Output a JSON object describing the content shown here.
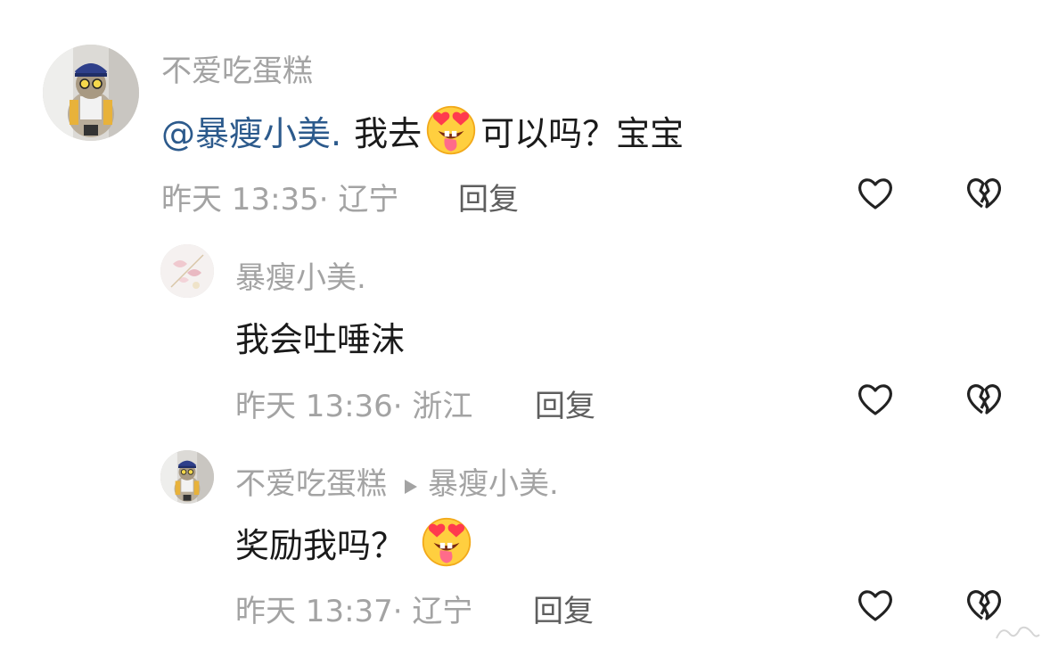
{
  "comments": [
    {
      "author": "不爱吃蛋糕",
      "mention": "@暴瘦小美.",
      "text_before_emoji": "我去",
      "text_after_emoji": "可以吗？宝宝",
      "emoji": "heart-eyes-tongue-emoji",
      "time": "昨天 13:35",
      "location": "· 辽宁",
      "reply_label": "回复",
      "like_icon": "heart-outline-icon",
      "dislike_icon": "broken-heart-icon"
    },
    {
      "author": "暴瘦小美.",
      "text": "我会吐唾沫",
      "time": "昨天 13:36",
      "location": "· 浙江",
      "reply_label": "回复",
      "like_icon": "heart-outline-icon",
      "dislike_icon": "broken-heart-icon"
    },
    {
      "author": "不爱吃蛋糕",
      "reply_to": "暴瘦小美.",
      "text": "奖励我吗？",
      "emoji": "heart-eyes-tongue-emoji",
      "time": "昨天 13:37",
      "location": "· 辽宁",
      "reply_label": "回复",
      "like_icon": "heart-outline-icon",
      "dislike_icon": "broken-heart-icon"
    }
  ],
  "colors": {
    "secondary_text": "#a3a3a3",
    "mention": "#2c5a8c",
    "primary_text": "#1a1a1a",
    "reply": "#5e5e5e"
  }
}
